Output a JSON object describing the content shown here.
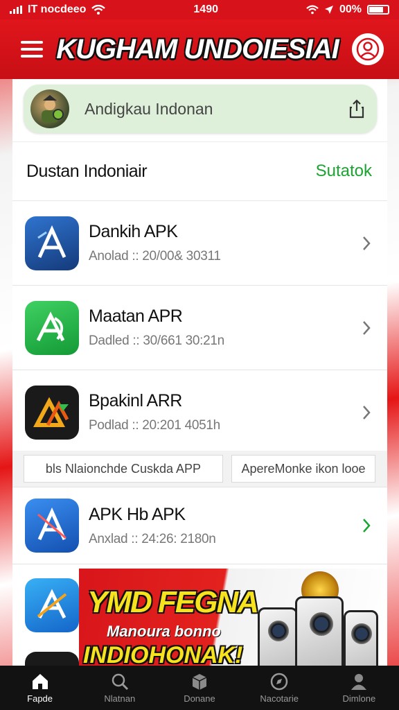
{
  "status_bar": {
    "carrier": "IT nocdeeo",
    "time": "1490",
    "battery": "00%"
  },
  "header": {
    "title": "KUGHAM UNDOIESIAI"
  },
  "search": {
    "placeholder": "Andigkau Indonan"
  },
  "section": {
    "title": "Dustan Indoniair",
    "action": "Sutatok"
  },
  "apps": [
    {
      "name": "Dankih APK",
      "meta": "Anolad ::  20/00&  30311",
      "icon_color": "#1c4f9c",
      "chevron_color": "#777777"
    },
    {
      "name": "Maatan APR",
      "meta": "Dadled ::  30/661  30:21n",
      "icon_color": "#1cb541",
      "chevron_color": "#777777"
    },
    {
      "name": "Bpakinl ARR",
      "meta": "Podlad ::  20:201  4051h",
      "icon_color": "#1a1a1a",
      "chevron_color": "#777777"
    },
    {
      "name": "APK Hb APK",
      "meta": "Anxlad ::  24:26:  2180n",
      "icon_color": "#1c63c9",
      "chevron_color": "#1aa530"
    }
  ],
  "tags": [
    "bls Nlaionchde Cuskda APP",
    "ApereMonke ikon looe"
  ],
  "banner": {
    "headline": "YMD FEGNA",
    "subline": "Manoura bonno",
    "subline2": "INDIOHONAK!"
  },
  "bottom_nav": [
    {
      "label": "Fapde",
      "icon": "home-icon",
      "active": true
    },
    {
      "label": "Nlatnan",
      "icon": "search-icon",
      "active": false
    },
    {
      "label": "Donane",
      "icon": "box-icon",
      "active": false
    },
    {
      "label": "Nacotarie",
      "icon": "compass-icon",
      "active": false
    },
    {
      "label": "Dimlone",
      "icon": "profile-icon",
      "active": false
    }
  ],
  "colors": {
    "brand_red": "#d8121a",
    "accent_green": "#1aa530",
    "nav_bg": "#121212"
  }
}
